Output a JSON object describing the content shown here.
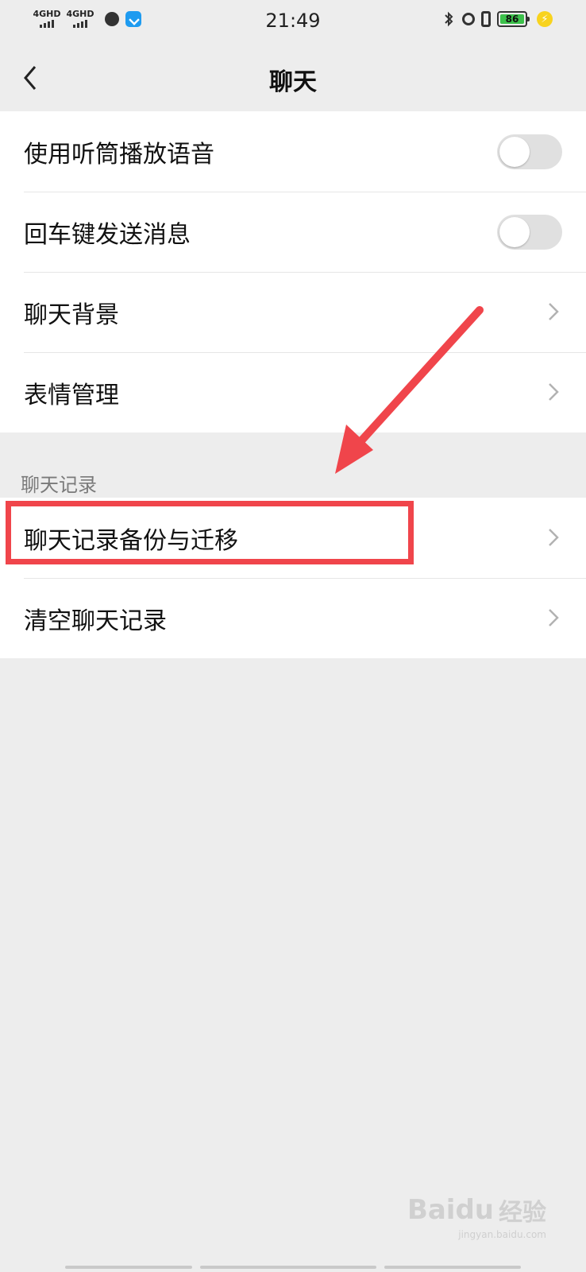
{
  "status_bar": {
    "network1": "4GHD",
    "network2": "4GHD",
    "time": "21:49",
    "bluetooth_icon": "bluetooth-icon",
    "battery_level": "86"
  },
  "nav": {
    "title": "聊天",
    "back_icon": "chevron-left-icon"
  },
  "group1": {
    "items": [
      {
        "label": "使用听筒播放语音",
        "control": "toggle",
        "on": false
      },
      {
        "label": "回车键发送消息",
        "control": "toggle",
        "on": false
      },
      {
        "label": "聊天背景",
        "control": "chevron"
      },
      {
        "label": "表情管理",
        "control": "chevron"
      }
    ]
  },
  "section": {
    "header": "聊天记录"
  },
  "group2": {
    "items": [
      {
        "label": "聊天记录备份与迁移",
        "control": "chevron",
        "highlighted": true
      },
      {
        "label": "清空聊天记录",
        "control": "chevron"
      }
    ]
  },
  "annotation": {
    "color": "#f0454b"
  },
  "watermark": {
    "logo": "Baidu",
    "text": "经验",
    "sub": "jingyan.baidu.com"
  }
}
